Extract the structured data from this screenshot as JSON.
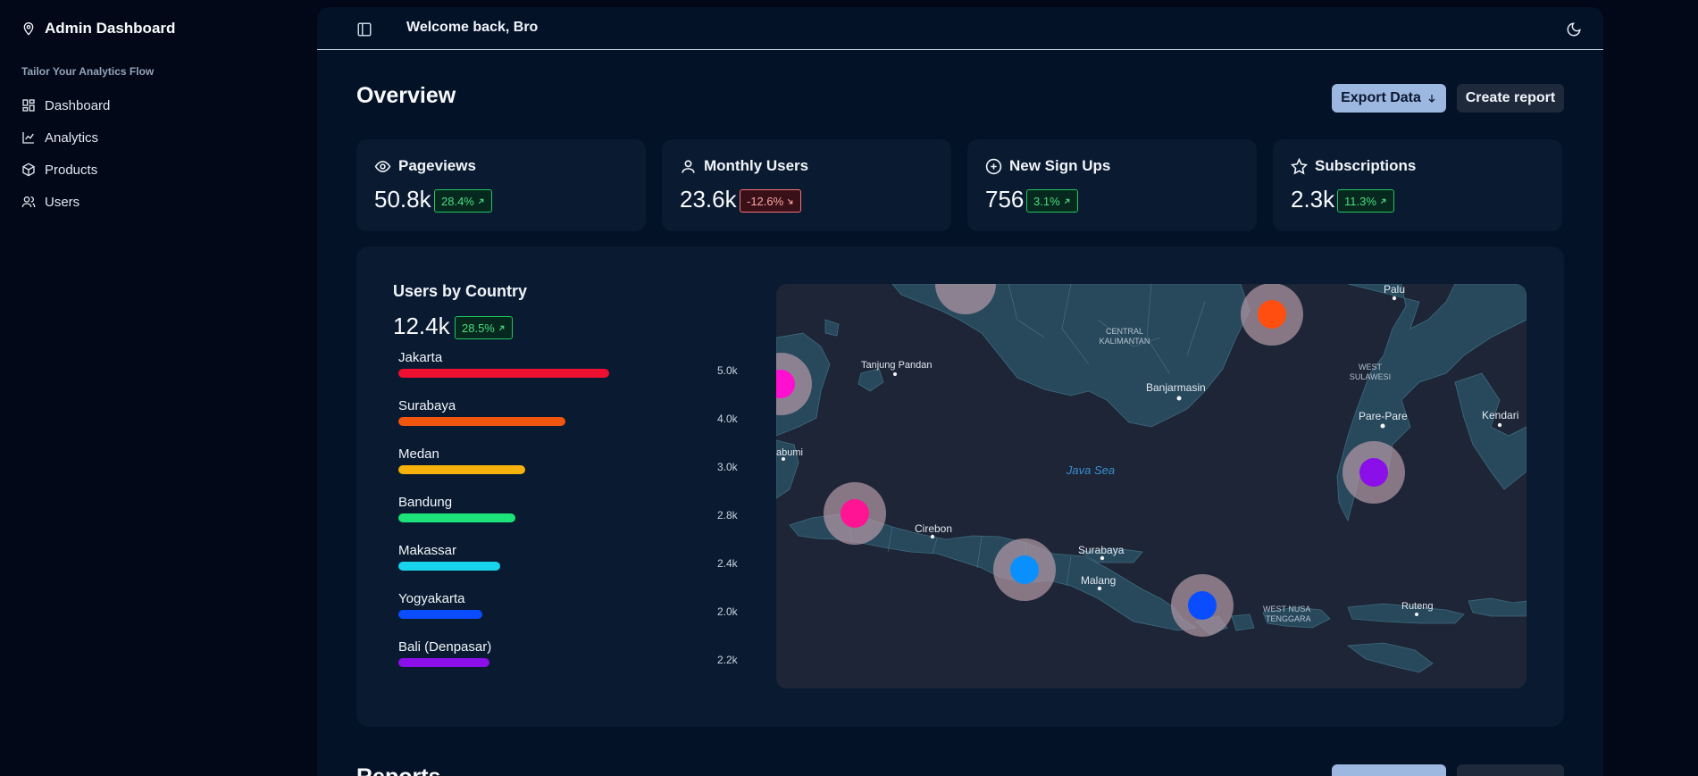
{
  "sidebar": {
    "brand": "Admin Dashboard",
    "section_label": "Tailor Your Analytics Flow",
    "items": [
      {
        "label": "Dashboard",
        "icon": "grid-icon"
      },
      {
        "label": "Analytics",
        "icon": "line-chart-icon"
      },
      {
        "label": "Products",
        "icon": "box-icon"
      },
      {
        "label": "Users",
        "icon": "users-icon"
      }
    ]
  },
  "topbar": {
    "welcome": "Welcome back, Bro"
  },
  "overview": {
    "title": "Overview",
    "export_label": "Export Data",
    "report_label": "Create report"
  },
  "stats": [
    {
      "title": "Pageviews",
      "value": "50.8k",
      "change": "28.4%",
      "trend": "up"
    },
    {
      "title": "Monthly Users",
      "value": "23.6k",
      "change": "-12.6%",
      "trend": "down"
    },
    {
      "title": "New Sign Ups",
      "value": "756",
      "change": "3.1%",
      "trend": "up"
    },
    {
      "title": "Subscriptions",
      "value": "2.3k",
      "change": "11.3%",
      "trend": "up"
    }
  ],
  "users_by_country": {
    "title": "Users by Country",
    "value": "12.4k",
    "change": "28.5%",
    "cities": [
      {
        "name": "Jakarta",
        "value_label": "5.0k",
        "fraction": 0.83,
        "color": "#ee0f31"
      },
      {
        "name": "Surabaya",
        "value_label": "4.0k",
        "fraction": 0.66,
        "color": "#f1560e"
      },
      {
        "name": "Medan",
        "value_label": "3.0k",
        "fraction": 0.5,
        "color": "#f6b10c"
      },
      {
        "name": "Bandung",
        "value_label": "2.8k",
        "fraction": 0.46,
        "color": "#1be37a"
      },
      {
        "name": "Makassar",
        "value_label": "2.4k",
        "fraction": 0.4,
        "color": "#18d3ec"
      },
      {
        "name": "Yogyakarta",
        "value_label": "2.0k",
        "fraction": 0.33,
        "color": "#0a4dff"
      },
      {
        "name": "Bali (Denpasar)",
        "value_label": "2.2k",
        "fraction": 0.36,
        "color": "#8a0fe8"
      }
    ]
  },
  "map": {
    "labels": {
      "central_kalimantan_1": "CENTRAL",
      "central_kalimantan_2": "KALIMANTAN",
      "tanjung_pandan": "Tanjung Pandan",
      "banjarmasin": "Banjarmasin",
      "palu": "Palu",
      "west_sulawesi_1": "WEST",
      "west_sulawesi_2": "SULAWESI",
      "pare_pare": "Pare-Pare",
      "kendari": "Kendari",
      "java_sea": "Java Sea",
      "sukabumi": "abumi",
      "cirebon": "Cirebon",
      "surabaya": "Surabaya",
      "malang": "Malang",
      "west_nusa_1": "WEST NUSA",
      "west_nusa_2": "TENGGARA",
      "ruteng": "Ruteng"
    },
    "marker_colors": {
      "jakarta": "#ff0fcf",
      "bandung": "#ff1493",
      "surabaya": "#0a8fff",
      "bali": "#0a4dff",
      "makassar": "#8a0fe8",
      "balikpapan": "#ff4e0f",
      "halo": "#b59aa6"
    }
  },
  "reports": {
    "title": "Reports"
  }
}
